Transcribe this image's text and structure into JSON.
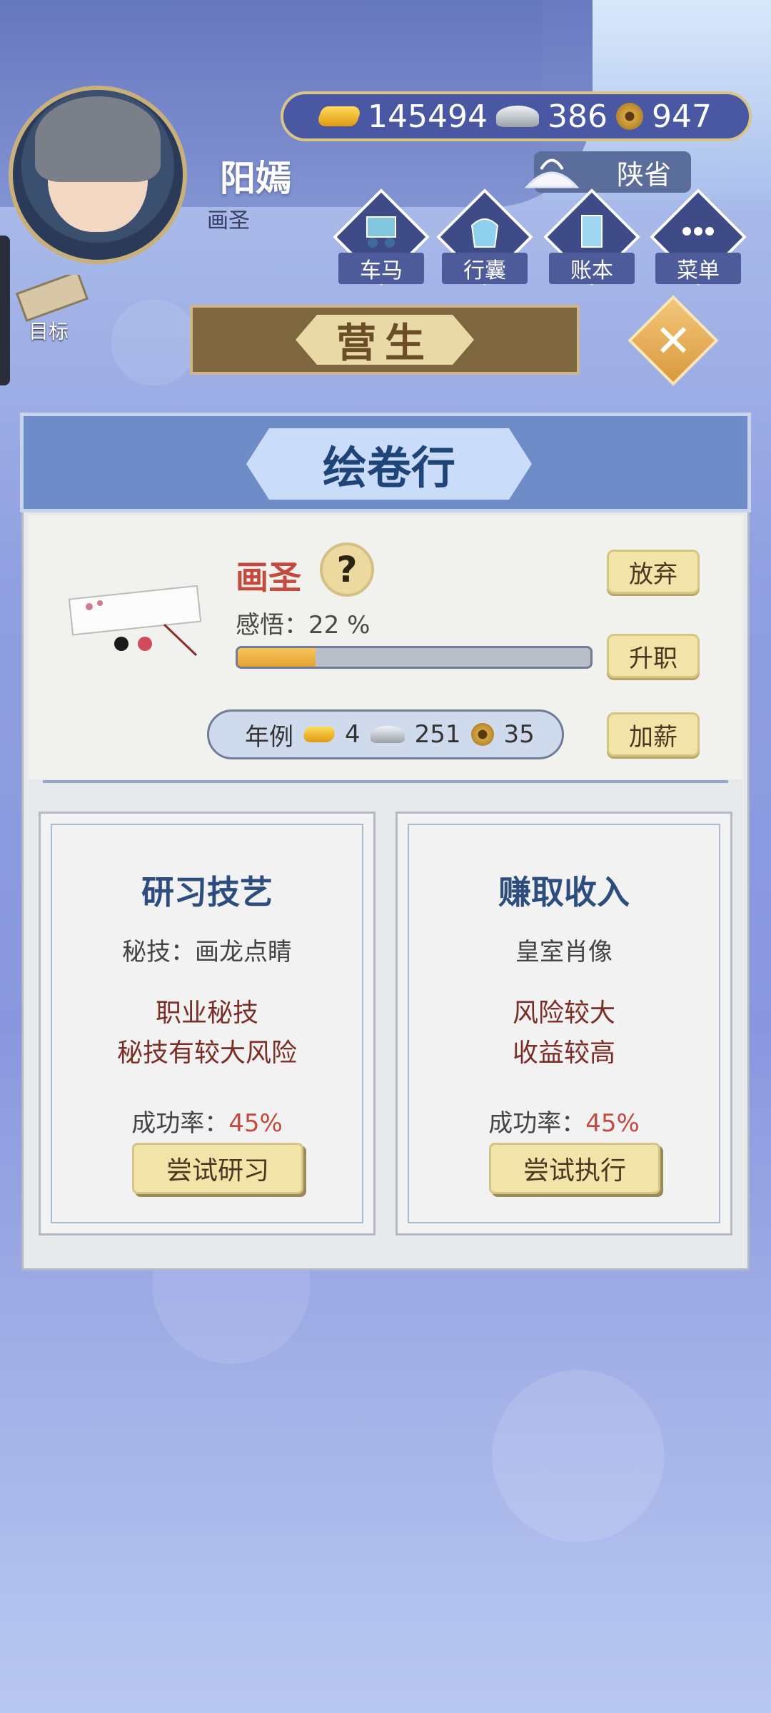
{
  "player": {
    "name": "阳嫣",
    "title": "画圣"
  },
  "currency": {
    "gold": "145494",
    "silver": "386",
    "copper": "947"
  },
  "region": "陕省",
  "nav": [
    {
      "label": "车马",
      "icon": "carriage-icon"
    },
    {
      "label": "行囊",
      "icon": "bag-icon"
    },
    {
      "label": "账本",
      "icon": "ledger-icon"
    },
    {
      "label": "菜单",
      "icon": "menu-icon"
    }
  ],
  "target_label": "目标",
  "section_title": "营生",
  "shop": {
    "title": "绘卷行",
    "job_name": "画圣",
    "insight_label": "感悟：",
    "insight_value": "22 %",
    "insight_fraction": 0.22,
    "salary_label": "年例",
    "salary_gold": "4",
    "salary_silver": "251",
    "salary_copper": "35",
    "buttons": {
      "quit": "放弃",
      "promote": "升职",
      "raise": "加薪"
    }
  },
  "options": [
    {
      "title": "研习技艺",
      "subtitle": "秘技：画龙点睛",
      "desc1": "职业秘技",
      "desc2": "秘技有较大风险",
      "rate_label": "成功率：",
      "rate_value": "45%",
      "button": "尝试研习"
    },
    {
      "title": "赚取收入",
      "subtitle": "皇室肖像",
      "desc1": "风险较大",
      "desc2": "收益较高",
      "rate_label": "成功率：",
      "rate_value": "45%",
      "button": "尝试执行"
    }
  ]
}
